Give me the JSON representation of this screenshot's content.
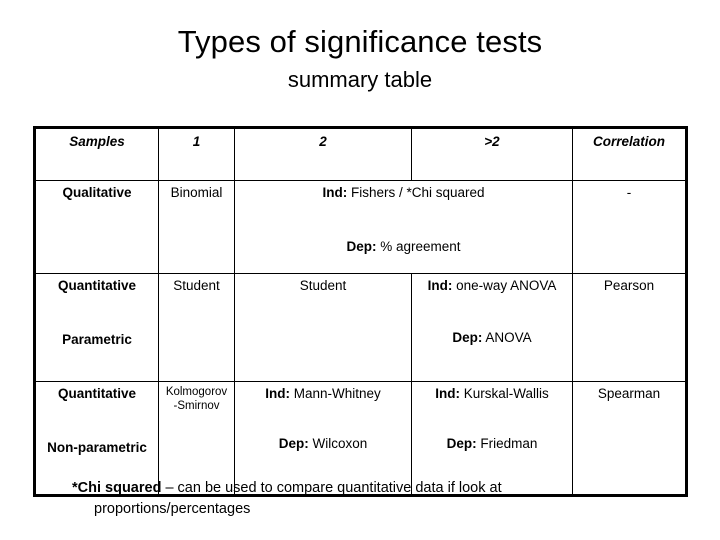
{
  "slide": {
    "title": "Types of significance tests",
    "subtitle": "summary table"
  },
  "table": {
    "headers": {
      "samples": "Samples",
      "one": "1",
      "two": "2",
      "gt2": ">2",
      "correlation": "Correlation"
    },
    "rows": [
      {
        "label_line1": "Qualitative",
        "label_line2": "",
        "col_one": "Binomial",
        "merged_two_gt2": {
          "ind_tag": "Ind:",
          "ind_text": "Fishers / *Chi squared",
          "dep_tag": "Dep:",
          "dep_text": "% agreement"
        },
        "correlation": "-"
      },
      {
        "label_line1": "Quantitative",
        "label_line2": "Parametric",
        "col_one": "Student",
        "col_two": "Student",
        "col_gt2": {
          "ind_tag": "Ind:",
          "ind_text": "one-way ANOVA",
          "dep_tag": "Dep:",
          "dep_text": "ANOVA"
        },
        "correlation": "Pearson"
      },
      {
        "label_line1": "Quantitative",
        "label_line2": "Non-parametric",
        "col_one_line1": "Kolmogorov",
        "col_one_line2": "-Smirnov",
        "col_two": {
          "ind_tag": "Ind:",
          "ind_text": "Mann-Whitney",
          "dep_tag": "Dep:",
          "dep_text": "Wilcoxon"
        },
        "col_gt2": {
          "ind_tag": "Ind:",
          "ind_text": "Kurskal-Wallis",
          "dep_tag": "Dep:",
          "dep_text": "Friedman"
        },
        "correlation": "Spearman"
      }
    ]
  },
  "footnote": {
    "bold_part": "*Chi squared",
    "rest": " – can be used to compare quantitative data if look at",
    "line2": "proportions/percentages"
  },
  "colors": {
    "text": "#000000",
    "background": "#ffffff",
    "border": "#000000"
  }
}
